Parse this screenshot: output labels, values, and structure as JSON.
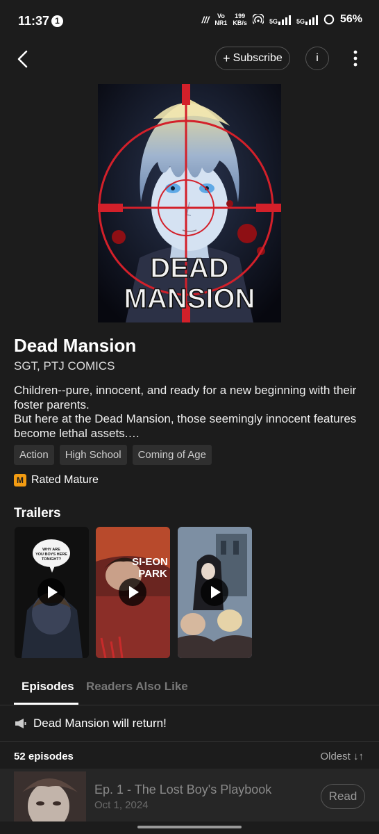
{
  "status_bar": {
    "time": "11:37",
    "notification_count": "1",
    "network_vo": "Vo",
    "network_nr": "NR1",
    "speed_value": "199",
    "speed_unit": "KB/s",
    "signal1_label": "5G",
    "signal2_label": "5G",
    "battery": "56%"
  },
  "header": {
    "subscribe_label": "Subscribe",
    "info_label": "i"
  },
  "series": {
    "cover_title_line1": "DEAD",
    "cover_title_line2": "MANSION",
    "title": "Dead Mansion",
    "author": "SGT, PTJ COMICS",
    "description": "Children--pure, innocent, and ready for a new beginning with their foster parents.\nBut here at the Dead Mansion, those seemingly innocent features become lethal assets.…",
    "tags": [
      "Action",
      "High School",
      "Coming of Age"
    ],
    "rating_badge": "M",
    "rating": "Rated Mature"
  },
  "trailers": {
    "heading": "Trailers",
    "items": [
      {
        "caption": "WHY ARE YOU BOYS HERE TONIGHT?"
      },
      {
        "caption": "SI-EON PARK"
      },
      {
        "caption": ""
      }
    ]
  },
  "tabs": {
    "episodes": "Episodes",
    "readers_also_like": "Readers Also Like"
  },
  "notice": {
    "text": "Dead Mansion will return!"
  },
  "episodes_list": {
    "count": "52 episodes",
    "sort": "Oldest",
    "items": [
      {
        "title": "Ep. 1 - The Lost Boy's Playbook",
        "date": "Oct 1, 2024",
        "action": "Read"
      }
    ]
  },
  "colors": {
    "background": "#1c1c1c",
    "accent_red": "#d3202a",
    "mature_badge": "#f39c12"
  }
}
